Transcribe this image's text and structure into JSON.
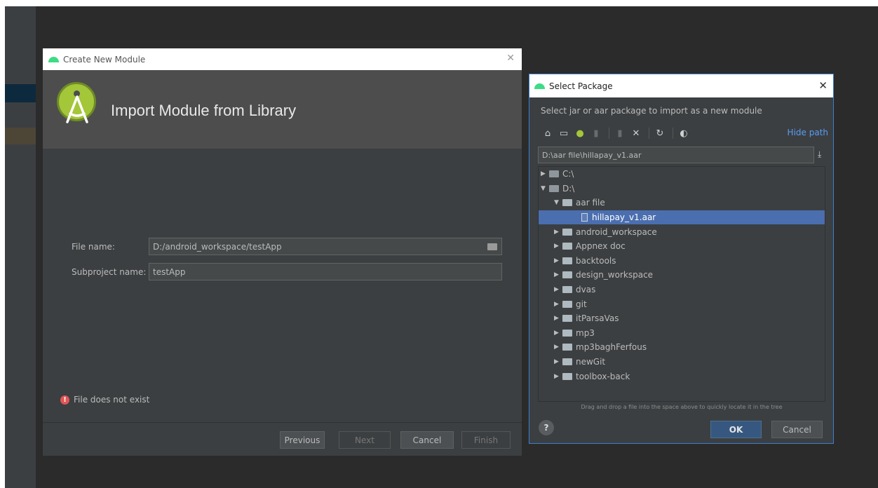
{
  "create_dialog": {
    "title": "Create New Module",
    "heading": "Import Module from Library",
    "file_name_label": "File name:",
    "file_name_value": "D:/android_workspace/testApp",
    "subproject_label": "Subproject name:",
    "subproject_value": "testApp",
    "error": "File does not exist",
    "buttons": {
      "previous": "Previous",
      "next": "Next",
      "cancel": "Cancel",
      "finish": "Finish"
    }
  },
  "select_dialog": {
    "title": "Select Package",
    "description": "Select jar or aar package to import as a new module",
    "hide_path": "Hide path",
    "path": "D:\\aar file\\hillapay_v1.aar",
    "tree": [
      {
        "label": "C:\\"
      },
      {
        "label": "D:\\"
      },
      {
        "label": "aar file"
      },
      {
        "label": "hillapay_v1.aar"
      },
      {
        "label": "android_workspace"
      },
      {
        "label": "Appnex doc"
      },
      {
        "label": "backtools"
      },
      {
        "label": "design_workspace"
      },
      {
        "label": "dvas"
      },
      {
        "label": "git"
      },
      {
        "label": "itParsaVas"
      },
      {
        "label": "mp3"
      },
      {
        "label": "mp3baghFerfous"
      },
      {
        "label": "newGit"
      },
      {
        "label": "toolbox-back"
      }
    ],
    "hint": "Drag and drop a file into the space above to quickly locate it in the tree",
    "help": "?",
    "ok": "OK",
    "cancel": "Cancel"
  },
  "colors": {
    "accent": "#4b6eaf",
    "ok_button": "#365880",
    "link": "#589df6",
    "error": "#e05555"
  },
  "icons": [
    "android-icon",
    "close-icon",
    "android-studio-logo",
    "folder-icon",
    "error-icon",
    "home-icon",
    "desktop-icon",
    "project-icon",
    "module-icon",
    "new-folder-icon",
    "delete-icon",
    "refresh-icon",
    "show-hidden-icon",
    "download-icon",
    "file-icon",
    "help-icon"
  ]
}
